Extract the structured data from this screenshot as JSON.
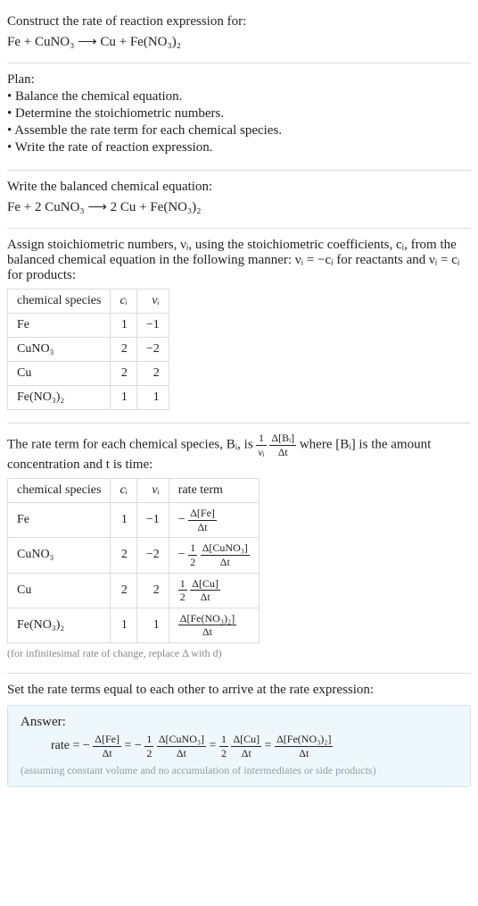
{
  "heading_line": "Construct the rate of reaction expression for:",
  "reaction_unbalanced": "Fe + CuNO₃ ⟶ Cu + Fe(NO₃)₂",
  "plan_label": "Plan:",
  "plan_items": [
    "Balance the chemical equation.",
    "Determine the stoichiometric numbers.",
    "Assemble the rate term for each chemical species.",
    "Write the rate of reaction expression."
  ],
  "balanced_heading": "Write the balanced chemical equation:",
  "reaction_balanced": "Fe + 2 CuNO₃ ⟶ 2 Cu + Fe(NO₃)₂",
  "stoich_heading_1": "Assign stoichiometric numbers, νᵢ, using the stoichiometric coefficients, cᵢ, from the balanced chemical equation in the following manner: νᵢ = −cᵢ for reactants and νᵢ = cᵢ for products:",
  "table1": {
    "headers": [
      "chemical species",
      "cᵢ",
      "νᵢ"
    ],
    "rows": [
      [
        "Fe",
        "1",
        "−1"
      ],
      [
        "CuNO₃",
        "2",
        "−2"
      ],
      [
        "Cu",
        "2",
        "2"
      ],
      [
        "Fe(NO₃)₂",
        "1",
        "1"
      ]
    ]
  },
  "rateterm_heading_pre": "The rate term for each chemical species, Bᵢ, is ",
  "rateterm_heading_post": " where [Bᵢ] is the amount concentration and t is time:",
  "rateterm_frac1_num": "1",
  "rateterm_frac1_den": "νᵢ",
  "rateterm_frac2_num": "Δ[Bᵢ]",
  "rateterm_frac2_den": "Δt",
  "table2": {
    "headers": [
      "chemical species",
      "cᵢ",
      "νᵢ",
      "rate term"
    ],
    "rows": [
      {
        "species": "Fe",
        "c": "1",
        "nu": "−1",
        "neg": "−",
        "half": false,
        "delta_num": "Δ[Fe]",
        "delta_den": "Δt"
      },
      {
        "species": "CuNO₃",
        "c": "2",
        "nu": "−2",
        "neg": "−",
        "half": true,
        "delta_num": "Δ[CuNO₃]",
        "delta_den": "Δt"
      },
      {
        "species": "Cu",
        "c": "2",
        "nu": "2",
        "neg": "",
        "half": true,
        "delta_num": "Δ[Cu]",
        "delta_den": "Δt"
      },
      {
        "species": "Fe(NO₃)₂",
        "c": "1",
        "nu": "1",
        "neg": "",
        "half": false,
        "delta_num": "Δ[Fe(NO₃)₂]",
        "delta_den": "Δt"
      }
    ]
  },
  "caption_text": "(for infinitesimal rate of change, replace Δ with d)",
  "setequal_heading": "Set the rate terms equal to each other to arrive at the rate expression:",
  "answer_label": "Answer:",
  "answer_rate_label": "rate = ",
  "answer_terms": [
    {
      "neg": "−",
      "half": false,
      "num": "Δ[Fe]",
      "den": "Δt"
    },
    {
      "neg": "−",
      "half": true,
      "num": "Δ[CuNO₃]",
      "den": "Δt"
    },
    {
      "neg": "",
      "half": true,
      "num": "Δ[Cu]",
      "den": "Δt"
    },
    {
      "neg": "",
      "half": false,
      "num": "Δ[Fe(NO₃)₂]",
      "den": "Δt"
    }
  ],
  "answer_subnote": "(assuming constant volume and no accumulation of intermediates or side products)",
  "half_num": "1",
  "half_den": "2",
  "eq_sign": " = ",
  "chart_data": {
    "type": "table",
    "tables": [
      {
        "title": "Stoichiometric numbers",
        "headers": [
          "chemical species",
          "c_i",
          "nu_i"
        ],
        "rows": [
          [
            "Fe",
            1,
            -1
          ],
          [
            "CuNO3",
            2,
            -2
          ],
          [
            "Cu",
            2,
            2
          ],
          [
            "Fe(NO3)2",
            1,
            1
          ]
        ]
      },
      {
        "title": "Rate terms",
        "headers": [
          "chemical species",
          "c_i",
          "nu_i",
          "rate term"
        ],
        "rows": [
          [
            "Fe",
            1,
            -1,
            "-d[Fe]/dt"
          ],
          [
            "CuNO3",
            2,
            -2,
            "-(1/2) d[CuNO3]/dt"
          ],
          [
            "Cu",
            2,
            2,
            "(1/2) d[Cu]/dt"
          ],
          [
            "Fe(NO3)2",
            1,
            1,
            "d[Fe(NO3)2]/dt"
          ]
        ]
      }
    ]
  }
}
